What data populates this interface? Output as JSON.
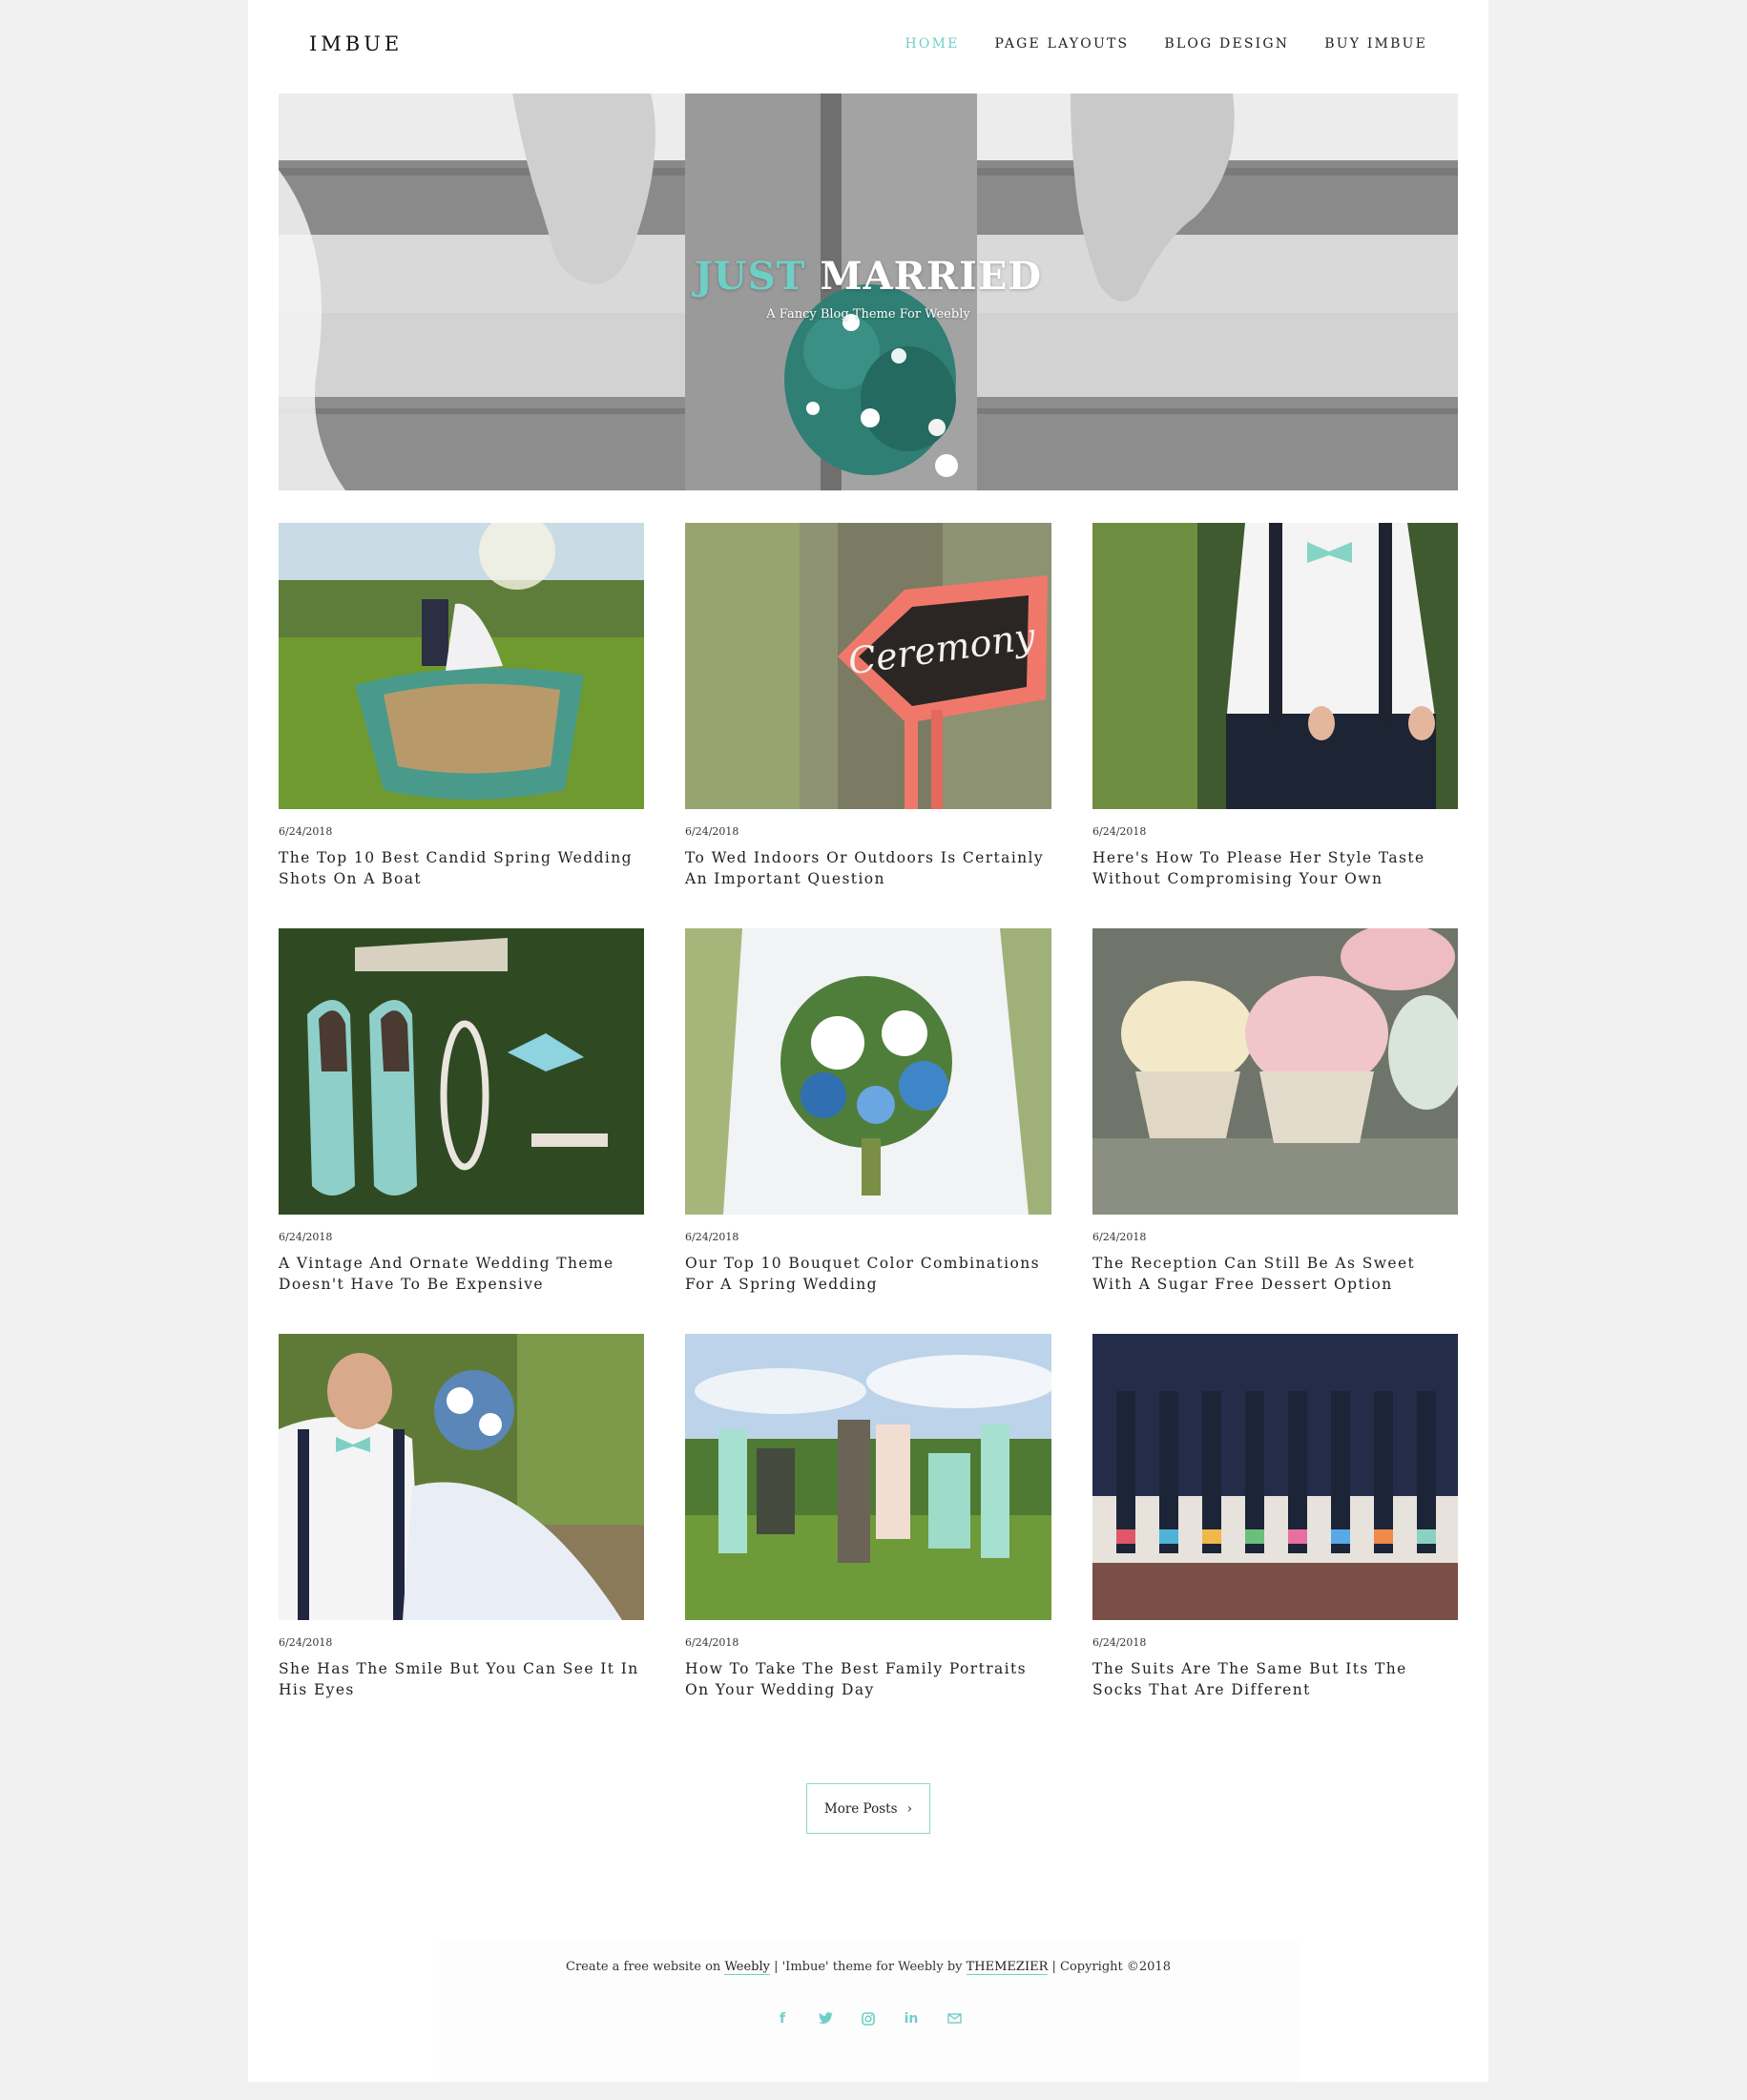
{
  "header": {
    "logo": "IMBUE",
    "nav": [
      "HOME",
      "PAGE LAYOUTS",
      "BLOG DESIGN",
      "BUY IMBUE"
    ]
  },
  "hero": {
    "title_accent": "JUST",
    "title_rest": "MARRIED",
    "subtitle": "A Fancy Blog Theme For Weebly"
  },
  "posts": [
    {
      "date": "6/24/2018",
      "title": "The Top 10 Best Candid Spring Wedding Shots On A Boat"
    },
    {
      "date": "6/24/2018",
      "title": "To Wed Indoors Or Outdoors Is Certainly An Important Question"
    },
    {
      "date": "6/24/2018",
      "title": "Here's How To Please Her Style Taste Without Compromising Your Own"
    },
    {
      "date": "6/24/2018",
      "title": "A Vintage And Ornate Wedding Theme Doesn't Have To Be Expensive"
    },
    {
      "date": "6/24/2018",
      "title": "Our Top 10 Bouquet Color Combinations For A Spring Wedding"
    },
    {
      "date": "6/24/2018",
      "title": "The Reception Can Still Be As Sweet With A Sugar Free Dessert Option"
    },
    {
      "date": "6/24/2018",
      "title": "She Has The Smile But You Can See It In His Eyes"
    },
    {
      "date": "6/24/2018",
      "title": "How To Take The Best Family Portraits On Your Wedding Day"
    },
    {
      "date": "6/24/2018",
      "title": "The Suits Are The Same But Its The Socks That Are Different"
    }
  ],
  "sign_text": "Ceremony",
  "more_button": {
    "label": "More Posts",
    "chevron": "›"
  },
  "footer": {
    "part1": "Create a free website on",
    "weebly": "Weebly",
    "part2": "  |  'Imbue' theme for Weebly by",
    "themezier": "THEMEZIER",
    "part3": "| Copyright ©2018",
    "social": [
      "facebook-icon",
      "twitter-icon",
      "instagram-icon",
      "linkedin-icon",
      "mail-icon"
    ]
  },
  "colors": {
    "accent": "#6fcfc6",
    "page_bg": "#f1f1f1"
  }
}
